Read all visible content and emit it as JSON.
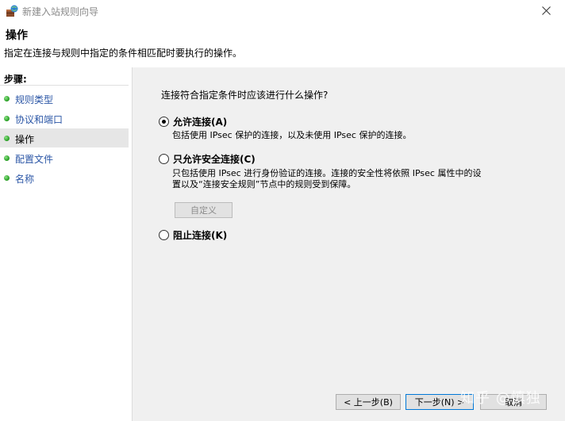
{
  "window": {
    "title": "新建入站规则向导",
    "icon": "firewall-icon"
  },
  "header": {
    "title": "操作",
    "description": "指定在连接与规则中指定的条件相匹配时要执行的操作。"
  },
  "sidebar": {
    "title": "步骤:",
    "items": [
      {
        "label": "规则类型"
      },
      {
        "label": "协议和端口"
      },
      {
        "label": "操作"
      },
      {
        "label": "配置文件"
      },
      {
        "label": "名称"
      }
    ]
  },
  "main": {
    "question": "连接符合指定条件时应该进行什么操作?",
    "options": [
      {
        "label": "允许连接(A)",
        "description": "包括使用 IPsec 保护的连接，以及未使用 IPsec 保护的连接。",
        "selected": true
      },
      {
        "label": "只允许安全连接(C)",
        "description_line1": "只包括使用 IPsec 进行身份验证的连接。连接的安全性将依照 IPsec 属性中的设",
        "description_line2": "置以及“连接安全规则”节点中的规则受到保障。",
        "selected": false
      },
      {
        "label": "阻止连接(K)",
        "selected": false
      }
    ],
    "customize_label": "自定义"
  },
  "footer": {
    "back_label": "< 上一步(B)",
    "next_label": "下一步(N) >",
    "cancel_label": "取消"
  },
  "watermark": "知乎 @慎独",
  "colors": {
    "link": "#2b56a6",
    "step_dot": "#2ea52a",
    "content_bg": "#f0f0f0",
    "primary_border": "#0078d7"
  }
}
